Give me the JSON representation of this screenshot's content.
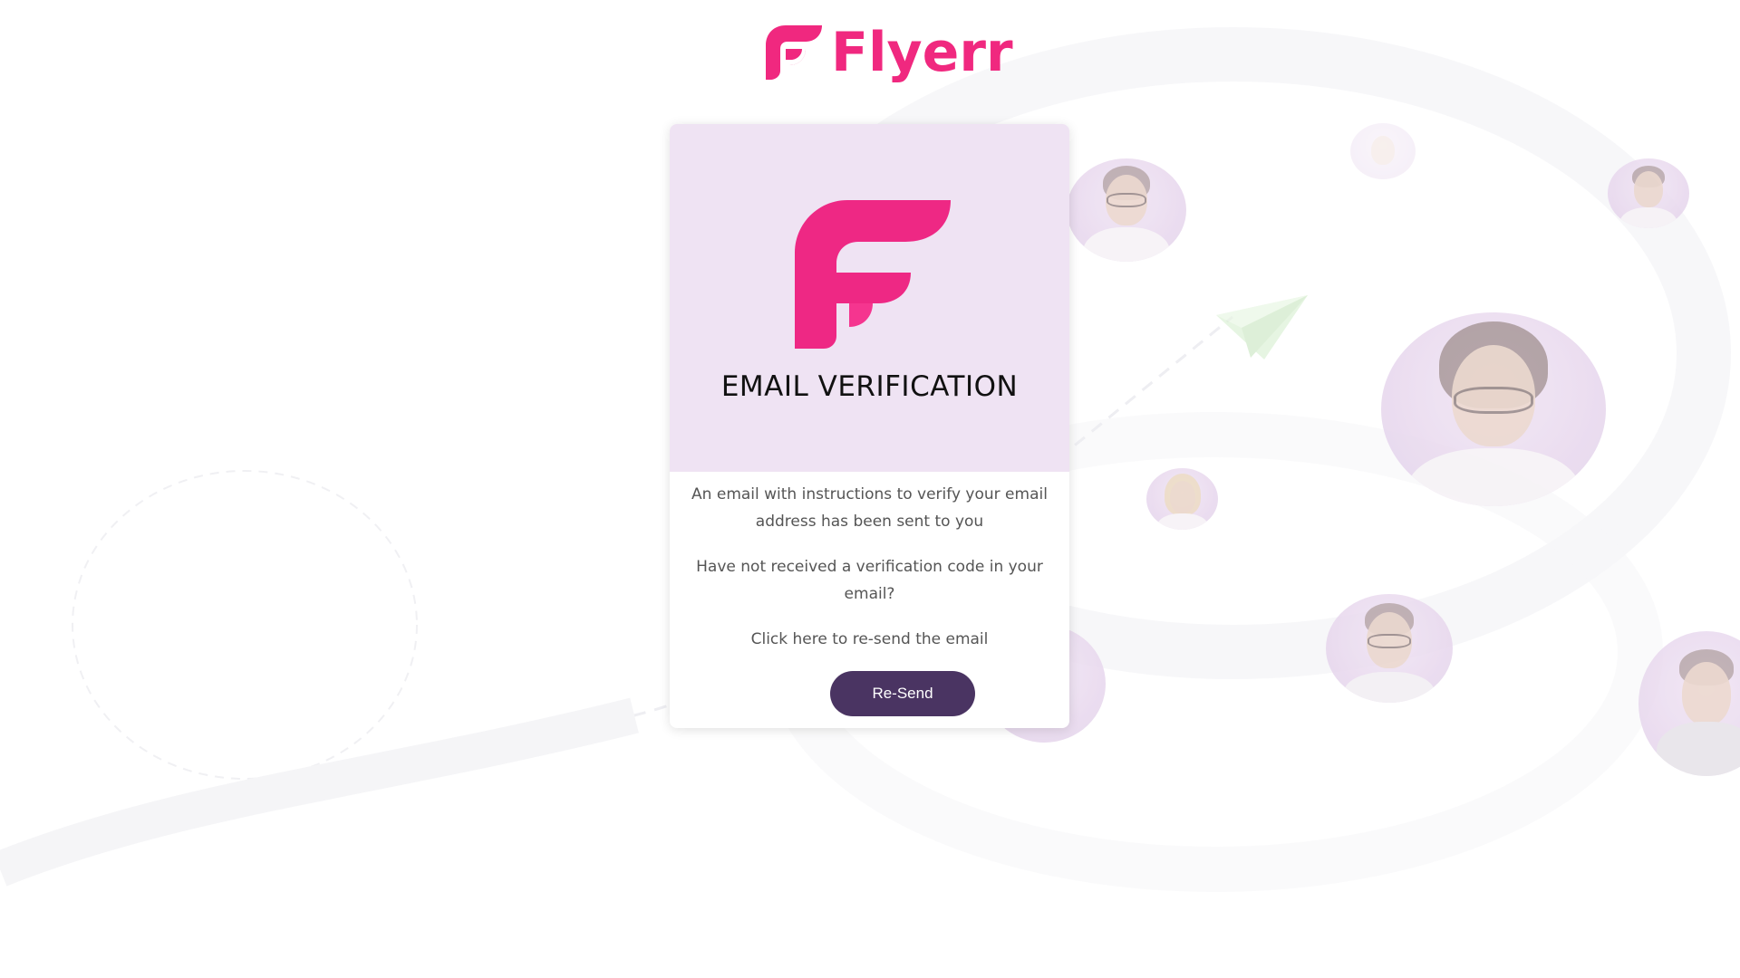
{
  "brand": {
    "name": "Flyerr",
    "logo_icon": "flyerr-f-logo-icon",
    "accent_color": "#f0287f"
  },
  "card": {
    "title": "EMAIL VERIFICATION",
    "message_line": "An email with instructions to verify your email address has been sent to you",
    "not_received": "Have not received a verification code in your email?",
    "resend_hint": "Click here to re-send the email",
    "resend_button": "Re-Send",
    "button_color": "#4a3462",
    "header_bg": "#efe3f3"
  },
  "background": {
    "icons": [
      "paper-plane-icon",
      "avatar-photo"
    ]
  }
}
